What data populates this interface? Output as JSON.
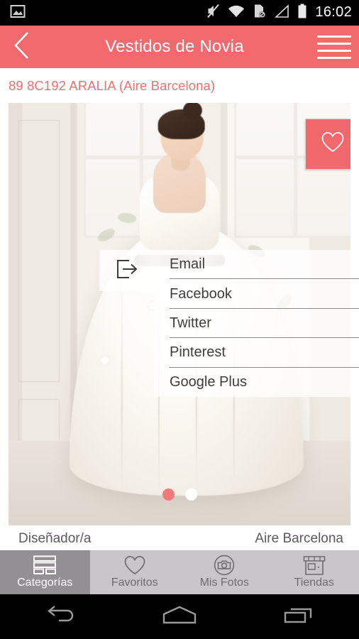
{
  "statusbar": {
    "time": "16:02",
    "icons": [
      "photo-icon",
      "mute-icon",
      "wifi-icon",
      "sd-card-blocked-icon",
      "signal-icon",
      "battery-icon"
    ]
  },
  "appbar": {
    "back_icon": "chevron-left-icon",
    "title": "Vestidos de Novia",
    "menu_icon": "hamburger-menu-icon",
    "background_color": "#f26a6e"
  },
  "content": {
    "item_title": "89 8C192 ARALIA (Aire Barcelona)",
    "item_title_color": "#f2706f",
    "favorite": {
      "icon": "heart-outline-icon",
      "color": "#f2696d"
    },
    "carousel": {
      "total": 2,
      "active_index": 0,
      "active_color": "#f4797a",
      "inactive_color": "#ffffff"
    },
    "spec_row": {
      "label": "Diseñador/a",
      "value": "Aire Barcelona"
    }
  },
  "share_popup": {
    "icon": "share-export-icon",
    "items": [
      {
        "label": "Email"
      },
      {
        "label": "Facebook"
      },
      {
        "label": "Twitter"
      },
      {
        "label": "Pinterest"
      },
      {
        "label": "Google Plus"
      }
    ]
  },
  "tabbar": {
    "selected_index": 0,
    "selected_bg": "#948f95",
    "bar_bg": "#c9c6c9",
    "items": [
      {
        "label": "Categorías",
        "icon": "categories-grid-icon"
      },
      {
        "label": "Favoritos",
        "icon": "heart-outline-icon"
      },
      {
        "label": "Mis Fotos",
        "icon": "camera-circle-icon"
      },
      {
        "label": "Tiendas",
        "icon": "storefront-icon"
      }
    ]
  },
  "navbar": {
    "items": [
      {
        "icon": "android-back-icon"
      },
      {
        "icon": "android-home-icon"
      },
      {
        "icon": "android-recents-icon"
      }
    ]
  }
}
